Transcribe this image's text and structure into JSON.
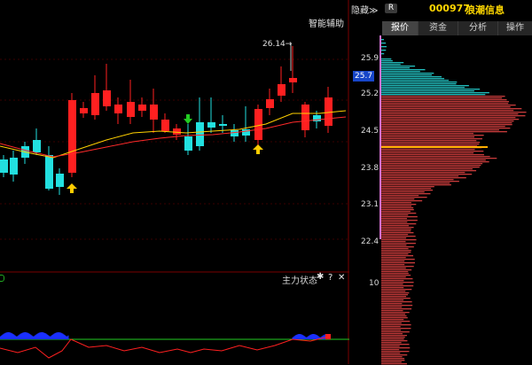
{
  "header": {
    "collapse_label": "隐藏",
    "collapse_glyph": "≫",
    "r_badge": "R",
    "stock_code": "000977",
    "stock_name": "浪潮信息",
    "assist_label": "智能辅助"
  },
  "tabs": [
    {
      "label": "报价"
    },
    {
      "label": "资金"
    },
    {
      "label": "分析"
    },
    {
      "label": "操作"
    }
  ],
  "price_axis": {
    "labels": [
      "25.9",
      "25.7",
      "25.2",
      "24.5",
      "23.8",
      "23.1",
      "22.4"
    ],
    "current": "25.7",
    "volume_label": "10"
  },
  "annotation": {
    "high_label": "26.14"
  },
  "indicator": {
    "title": "主力状态",
    "help": "?",
    "close": "✕"
  },
  "colors": {
    "up": "#ff2020",
    "down": "#22e0e0",
    "ma_fast": "#ffd000",
    "ma_slow": "#ff2a2a",
    "vol_profile_teal": "#22bfbf",
    "vol_profile_red": "#c83b3b",
    "current_line": "#ffb000",
    "arrow_up": "#ffcc00",
    "arrow_down": "#22cc22"
  }
}
